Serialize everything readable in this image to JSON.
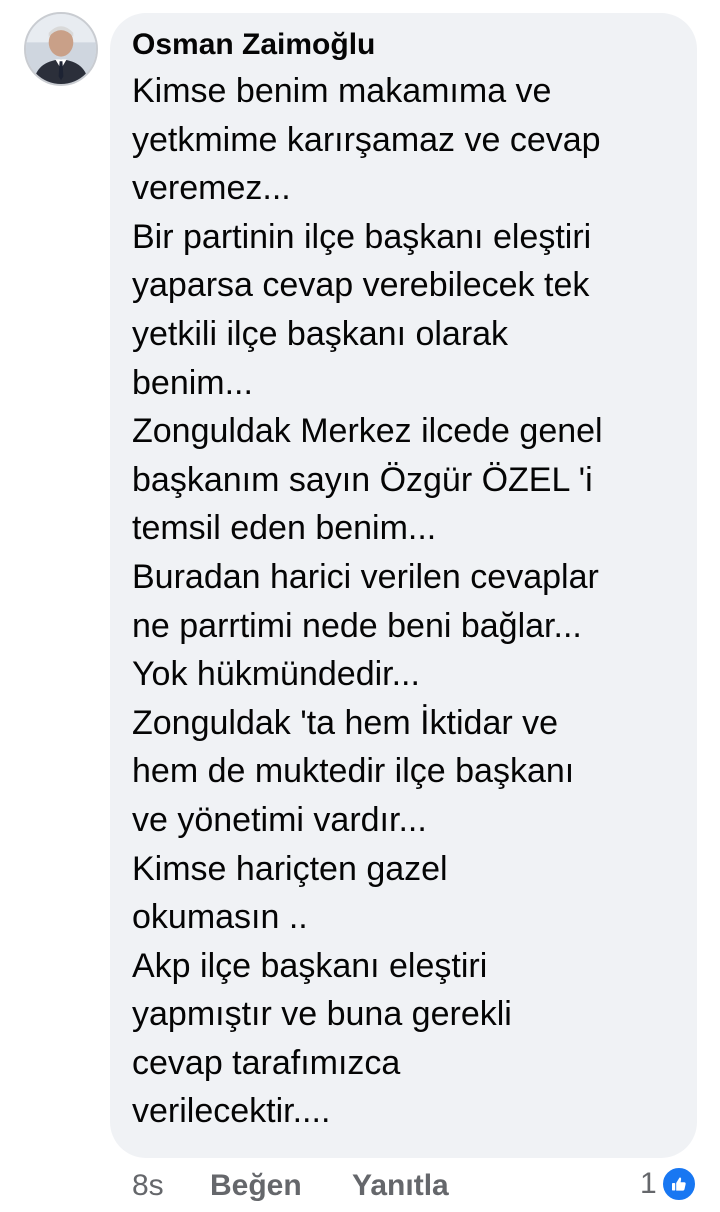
{
  "comment": {
    "author": "Osman Zaimoğlu",
    "body_lines": [
      "Kimse benim makamıma ve",
      "yetkmime karırşamaz ve cevap",
      "veremez...",
      "Bir partinin ilçe başkanı eleştiri",
      "yaparsa cevap verebilecek tek",
      "yetkili ilçe başkanı olarak",
      "benim...",
      "Zonguldak Merkez ilcede genel",
      "başkanım sayın Özgür ÖZEL 'i",
      "temsil eden benim...",
      "Buradan harici verilen cevaplar",
      "ne parrtimi nede beni bağlar...",
      "Yok hükmündedir...",
      "Zonguldak 'ta hem İktidar ve",
      "hem de muktedir ilçe başkanı",
      "ve yönetimi vardır...",
      "Kimse hariçten gazel",
      "okumasın ..",
      "Akp ilçe başkanı eleştiri",
      "yapmıştır ve buna gerekli",
      "cevap tarafımızca",
      "verilecektir...."
    ]
  },
  "footer": {
    "time": "8s",
    "like_label": "Beğen",
    "reply_label": "Yanıtla",
    "reaction_count": "1",
    "reaction_icon": "thumbs-up-icon"
  },
  "colors": {
    "bubble_bg": "#f0f2f5",
    "text": "#050505",
    "meta": "#65676b",
    "like_blue": "#1877f2"
  }
}
